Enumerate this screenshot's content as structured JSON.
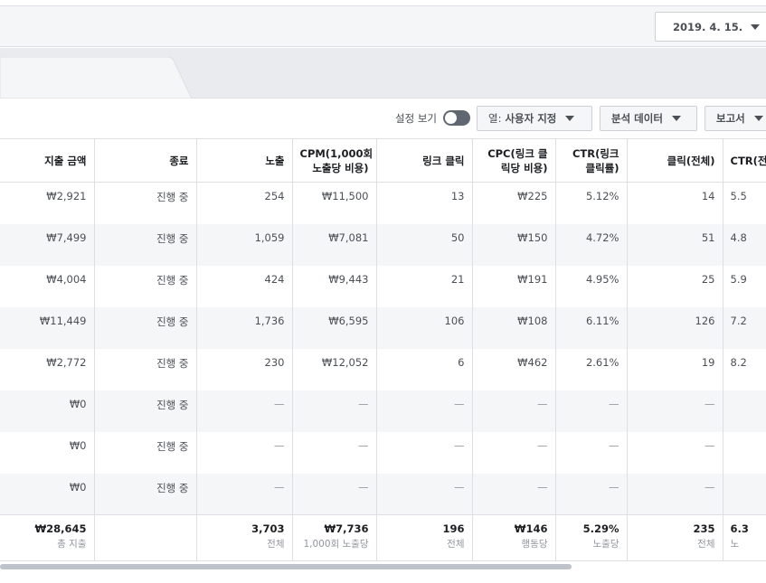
{
  "header": {
    "date": "2019. 4. 15."
  },
  "toolbar": {
    "breakdown_label": "설정 보기",
    "columns_prefix": "열:",
    "columns_value": "사용자 지정",
    "analyze_label": "분석 데이터",
    "reports_label": "보고서"
  },
  "table": {
    "headers": [
      {
        "line1": "지출 금액",
        "line2": ""
      },
      {
        "line1": "종료",
        "line2": ""
      },
      {
        "line1": "노출",
        "line2": ""
      },
      {
        "line1": "CPM(1,000회",
        "line2": "노출당 비용)"
      },
      {
        "line1": "링크 클릭",
        "line2": ""
      },
      {
        "line1": "CPC(링크 클",
        "line2": "릭당 비용)"
      },
      {
        "line1": "CTR(링크",
        "line2": "클릭률)"
      },
      {
        "line1": "클릭(전체)",
        "line2": ""
      },
      {
        "line1": "CTR(전",
        "line2": ""
      }
    ],
    "rows": [
      [
        "₩2,921",
        "진행 중",
        "254",
        "₩11,500",
        "13",
        "₩225",
        "5.12%",
        "14",
        "5.5"
      ],
      [
        "₩7,499",
        "진행 중",
        "1,059",
        "₩7,081",
        "50",
        "₩150",
        "4.72%",
        "51",
        "4.8"
      ],
      [
        "₩4,004",
        "진행 중",
        "424",
        "₩9,443",
        "21",
        "₩191",
        "4.95%",
        "25",
        "5.9"
      ],
      [
        "₩11,449",
        "진행 중",
        "1,736",
        "₩6,595",
        "106",
        "₩108",
        "6.11%",
        "126",
        "7.2"
      ],
      [
        "₩2,772",
        "진행 중",
        "230",
        "₩12,052",
        "6",
        "₩462",
        "2.61%",
        "19",
        "8.2"
      ],
      [
        "₩0",
        "진행 중",
        "—",
        "—",
        "—",
        "—",
        "—",
        "—",
        ""
      ],
      [
        "₩0",
        "진행 중",
        "—",
        "—",
        "—",
        "—",
        "—",
        "—",
        ""
      ],
      [
        "₩0",
        "진행 중",
        "—",
        "—",
        "—",
        "—",
        "—",
        "—",
        ""
      ]
    ],
    "totals": [
      {
        "value": "₩28,645",
        "label": "총 지출"
      },
      {
        "value": "",
        "label": ""
      },
      {
        "value": "3,703",
        "label": "전체"
      },
      {
        "value": "₩7,736",
        "label": "1,000회 노출당"
      },
      {
        "value": "196",
        "label": "전체"
      },
      {
        "value": "₩146",
        "label": "행동당"
      },
      {
        "value": "5.29%",
        "label": "노출당"
      },
      {
        "value": "235",
        "label": "전체"
      },
      {
        "value": "6.3",
        "label": "노"
      }
    ]
  }
}
